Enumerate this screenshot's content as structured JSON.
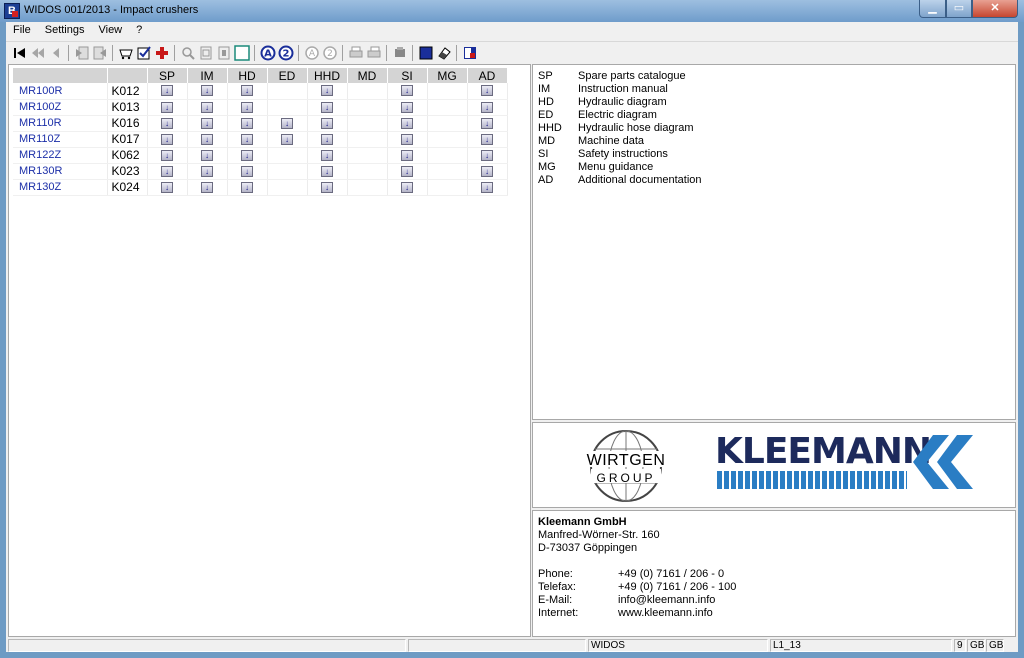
{
  "window": {
    "title": "WIDOS 001/2013 - Impact crushers",
    "app_icon": "B"
  },
  "menu": [
    "File",
    "Settings",
    "View",
    "?"
  ],
  "table": {
    "headers": [
      "",
      "",
      "SP",
      "IM",
      "HD",
      "ED",
      "HHD",
      "MD",
      "SI",
      "MG",
      "AD"
    ],
    "download_glyph": "↓",
    "rows": [
      {
        "machine": "MR100R",
        "code": "K012",
        "docs": [
          1,
          1,
          1,
          0,
          1,
          0,
          1,
          0,
          1
        ]
      },
      {
        "machine": "MR100Z",
        "code": "K013",
        "docs": [
          1,
          1,
          1,
          0,
          1,
          0,
          1,
          0,
          1
        ]
      },
      {
        "machine": "MR110R",
        "code": "K016",
        "docs": [
          1,
          1,
          1,
          1,
          1,
          0,
          1,
          0,
          1
        ]
      },
      {
        "machine": "MR110Z",
        "code": "K017",
        "docs": [
          1,
          1,
          1,
          1,
          1,
          0,
          1,
          0,
          1
        ]
      },
      {
        "machine": "MR122Z",
        "code": "K062",
        "docs": [
          1,
          1,
          1,
          0,
          1,
          0,
          1,
          0,
          1
        ]
      },
      {
        "machine": "MR130R",
        "code": "K023",
        "docs": [
          1,
          1,
          1,
          0,
          1,
          0,
          1,
          0,
          1
        ]
      },
      {
        "machine": "MR130Z",
        "code": "K024",
        "docs": [
          1,
          1,
          1,
          0,
          1,
          0,
          1,
          0,
          1
        ]
      }
    ]
  },
  "legend": [
    {
      "code": "SP",
      "label": "Spare parts catalogue"
    },
    {
      "code": "IM",
      "label": "Instruction manual"
    },
    {
      "code": "HD",
      "label": "Hydraulic diagram"
    },
    {
      "code": "ED",
      "label": "Electric diagram"
    },
    {
      "code": "HHD",
      "label": "Hydraulic hose diagram"
    },
    {
      "code": "MD",
      "label": "Machine data"
    },
    {
      "code": "SI",
      "label": "Safety instructions"
    },
    {
      "code": "MG",
      "label": "Menu guidance"
    },
    {
      "code": "AD",
      "label": "Additional documentation"
    }
  ],
  "logos": {
    "wirtgen_name": "WIRTGEN",
    "wirtgen_group": "GROUP",
    "kleemann": "KLEEMANN"
  },
  "contact": {
    "company": "Kleemann GmbH",
    "street": "Manfred-Wörner-Str. 160",
    "city": "D-73037 Göppingen",
    "phone_label": "Phone:",
    "phone": "+49 (0) 7161 / 206 - 0",
    "fax_label": "Telefax:",
    "fax": "+49 (0) 7161 / 206 - 100",
    "email_label": "E-Mail:",
    "email": "info@kleemann.info",
    "web_label": "Internet:",
    "web": "www.kleemann.info"
  },
  "status": {
    "app": "WIDOS",
    "level": "L1_13",
    "num": "9",
    "lang1": "GB",
    "lang2": "GB"
  },
  "colors": {
    "link": "#1c2fa8",
    "kleemann_dark": "#1d2a5c",
    "kleemann_blue": "#2a7dc4"
  }
}
